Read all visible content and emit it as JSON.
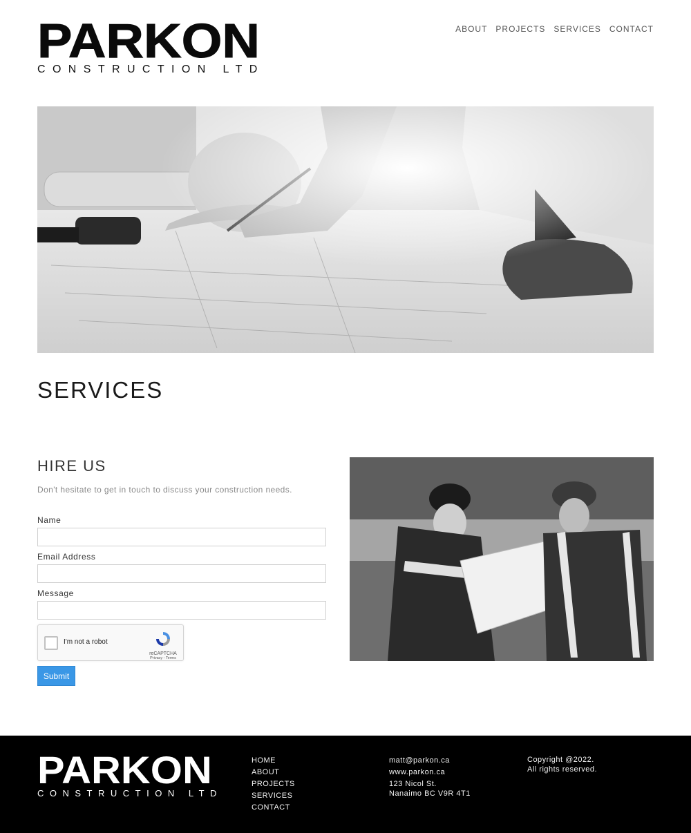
{
  "brand": {
    "name": "PARKON",
    "tagline": "CONSTRUCTION LTD"
  },
  "nav": {
    "items": [
      {
        "label": "ABOUT"
      },
      {
        "label": "PROJECTS"
      },
      {
        "label": "SERVICES"
      },
      {
        "label": "CONTACT"
      }
    ]
  },
  "page": {
    "title": "SERVICES"
  },
  "hire": {
    "title": "HIRE US",
    "description": "Don't hesitate to get in touch to discuss your construction needs.",
    "fields": {
      "name_label": "Name",
      "email_label": "Email Address",
      "message_label": "Message"
    },
    "captcha": {
      "label": "I'm not a robot",
      "brand": "reCAPTCHA",
      "links": "Privacy - Terms"
    },
    "submit_label": "Submit"
  },
  "footer": {
    "nav": [
      {
        "label": "HOME"
      },
      {
        "label": "ABOUT"
      },
      {
        "label": "PROJECTS"
      },
      {
        "label": "SERVICES"
      },
      {
        "label": "CONTACT"
      }
    ],
    "contact": {
      "email": "matt@parkon.ca",
      "website": "www.parkon.ca",
      "address_line1": "123 Nicol St.",
      "address_line2": "Nanaimo BC V9R 4T1"
    },
    "copyright_line1": "Copyright @2022.",
    "copyright_line2": "All rights reserved."
  },
  "colors": {
    "submit": "#3a97e6",
    "footer_bg": "#000000"
  }
}
